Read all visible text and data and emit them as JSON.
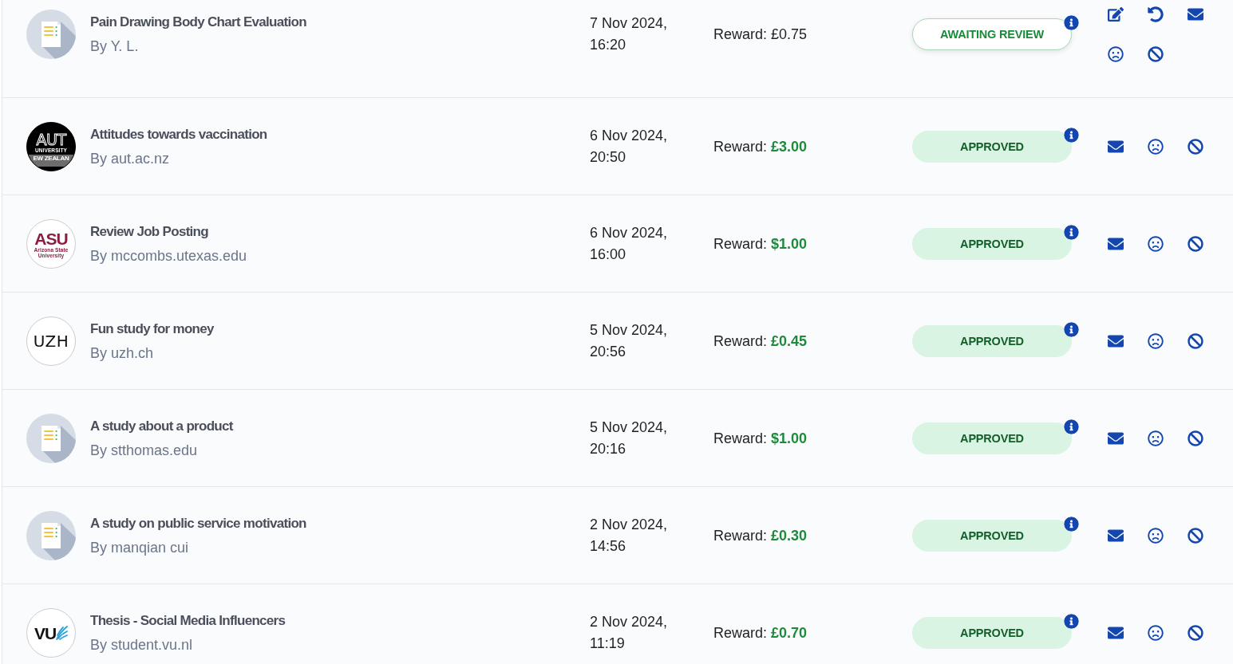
{
  "submissions": [
    {
      "avatar": {
        "kind": "document"
      },
      "title": "Pain Drawing Body Chart Evaluation",
      "byline": "By Y. L.",
      "date": "7 Nov 2024, 16:20",
      "reward_label": "Reward:",
      "reward": "£0.75",
      "status": {
        "kind": "awaiting",
        "label": "AWAITING REVIEW"
      },
      "actions": [
        {
          "kind": "edit"
        },
        {
          "kind": "undo"
        },
        {
          "kind": "message"
        },
        {
          "kind": "sad"
        },
        {
          "kind": "block"
        }
      ]
    },
    {
      "avatar": {
        "kind": "dark_logo",
        "lines": [
          {
            "kind": "outline",
            "text": "AUT"
          },
          {
            "kind": "small",
            "text": "UNIVERSITY"
          },
          {
            "kind": "band",
            "text": "EW ZEALAN"
          }
        ]
      },
      "title": "Attitudes towards vaccination",
      "byline": "By aut.ac.nz",
      "date": "6 Nov 2024, 20:50",
      "reward_label": "Reward:",
      "reward": "£3.00",
      "status": {
        "kind": "approved",
        "label": "APPROVED"
      },
      "actions": [
        {
          "kind": "message"
        },
        {
          "kind": "sad"
        },
        {
          "kind": "block"
        }
      ]
    },
    {
      "avatar": {
        "kind": "light_logo",
        "color": "#8c1d40",
        "lines": [
          {
            "kind": "heavy",
            "text": "ASU"
          },
          {
            "kind": "small",
            "text": "Arizona State"
          },
          {
            "kind": "small",
            "text": "University"
          }
        ]
      },
      "title": "Review Job Posting",
      "byline": "By mccombs.utexas.edu",
      "date": "6 Nov 2024, 16:00",
      "reward_label": "Reward:",
      "reward": "$1.00",
      "status": {
        "kind": "approved",
        "label": "APPROVED"
      },
      "actions": [
        {
          "kind": "message"
        },
        {
          "kind": "sad"
        },
        {
          "kind": "block"
        }
      ]
    },
    {
      "avatar": {
        "kind": "light_logo",
        "color": "#111111",
        "lines": [
          {
            "kind": "plain",
            "text": "UZH"
          }
        ]
      },
      "title": "Fun study for money",
      "byline": "By uzh.ch",
      "date": "5 Nov 2024, 20:56",
      "reward_label": "Reward:",
      "reward": "£0.45",
      "status": {
        "kind": "approved",
        "label": "APPROVED"
      },
      "actions": [
        {
          "kind": "message"
        },
        {
          "kind": "sad"
        },
        {
          "kind": "block"
        }
      ]
    },
    {
      "avatar": {
        "kind": "document"
      },
      "title": "A study about a product",
      "byline": "By stthomas.edu",
      "date": "5 Nov 2024, 20:16",
      "reward_label": "Reward:",
      "reward": "$1.00",
      "status": {
        "kind": "approved",
        "label": "APPROVED"
      },
      "actions": [
        {
          "kind": "message"
        },
        {
          "kind": "sad"
        },
        {
          "kind": "block"
        }
      ]
    },
    {
      "avatar": {
        "kind": "document"
      },
      "title": "A study on public service motivation",
      "byline": "By manqian cui",
      "date": "2 Nov 2024, 14:56",
      "reward_label": "Reward:",
      "reward": "£0.30",
      "status": {
        "kind": "approved",
        "label": "APPROVED"
      },
      "actions": [
        {
          "kind": "message"
        },
        {
          "kind": "sad"
        },
        {
          "kind": "block"
        }
      ]
    },
    {
      "avatar": {
        "kind": "light_logo",
        "color": "#111111",
        "lines": [
          {
            "kind": "heavy",
            "text": "VU"
          },
          {
            "kind": "wing"
          }
        ]
      },
      "title": "Thesis - Social Media Influencers",
      "byline": "By student.vu.nl",
      "date": "2 Nov 2024, 11:19",
      "reward_label": "Reward:",
      "reward": "£0.70",
      "status": {
        "kind": "approved",
        "label": "APPROVED"
      },
      "actions": [
        {
          "kind": "message"
        },
        {
          "kind": "sad"
        },
        {
          "kind": "block"
        }
      ]
    }
  ]
}
